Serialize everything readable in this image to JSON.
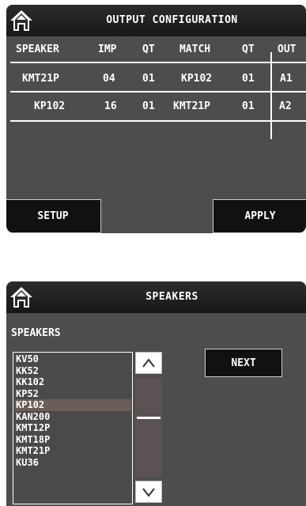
{
  "output_config": {
    "title": "OUTPUT CONFIGURATION",
    "headers": [
      "SPEAKER",
      "IMP",
      "QT",
      "MATCH",
      "QT",
      "OUT"
    ],
    "rows": [
      {
        "speaker": "KMT21P",
        "imp": "04",
        "qt": "01",
        "match": "KP102",
        "qt2": "01",
        "out": "A1"
      },
      {
        "speaker": "KP102",
        "imp": "16",
        "qt": "01",
        "match": "KMT21P",
        "qt2": "01",
        "out": "A2"
      }
    ],
    "setup_label": "SETUP",
    "apply_label": "APPLY"
  },
  "speakers_panel": {
    "title": "SPEAKERS",
    "list_label": "SPEAKERS",
    "items": [
      "KV50",
      "KK52",
      "KK102",
      "KP52",
      "KP102",
      "KAN200",
      "KMT12P",
      "KMT18P",
      "KMT21P",
      "KU36"
    ],
    "selected": "KP102",
    "next_label": "NEXT"
  },
  "icons": {
    "home": "home-icon",
    "scroll_up": "chevron-up-icon",
    "scroll_down": "chevron-down-icon"
  },
  "colors": {
    "panel_bg": "#4d4d4d",
    "titlebar_bg": "#1c1c1c",
    "button_bg": "#111111",
    "selected_row": "#6a5e58",
    "text": "#ffffff"
  }
}
